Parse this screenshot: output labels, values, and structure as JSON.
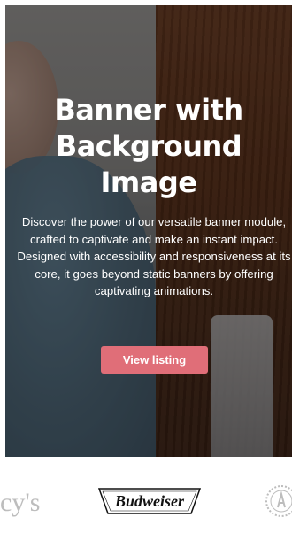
{
  "banner": {
    "title_lines": [
      "Banner with",
      "Background",
      "Image"
    ],
    "description": "Discover the power of our versatile banner module, crafted to captivate and make an instant impact. Designed with accessibility and responsiveness at its core, it goes beyond static banners by offering captivating animations.",
    "cta_label": "View listing",
    "cta_color": "#e06e78"
  },
  "logos": {
    "left_partial_text": "cy's",
    "center_brand": "Budweiser"
  }
}
